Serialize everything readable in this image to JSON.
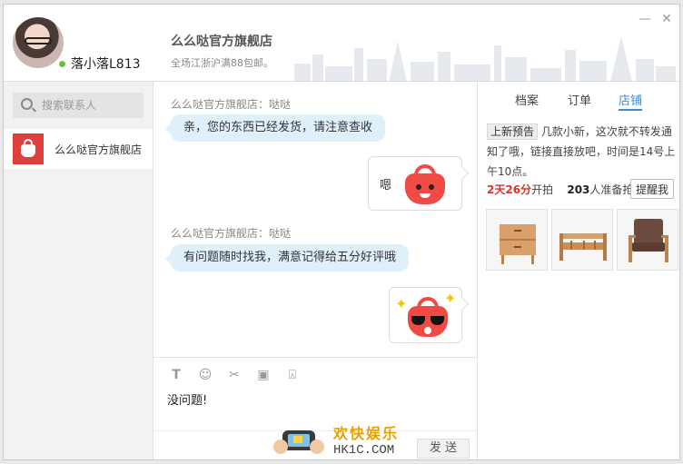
{
  "header": {
    "user_name": "落小落L813",
    "shop_title": "么么哒官方旗舰店",
    "shop_subtitle": "全场江浙沪满88包邮。"
  },
  "window_controls": {
    "minimize": "—",
    "close": "✕"
  },
  "sidebar": {
    "search_placeholder": "搜索联系人",
    "contacts": [
      {
        "name": "么么哒官方旗舰店",
        "icon": "red-bag-logo-icon"
      }
    ]
  },
  "chat": {
    "messages": [
      {
        "sender": "么么哒官方旗舰店：哒哒",
        "text": "亲，您的东西已经发货，请注意查收"
      },
      {
        "mine_text": "嗯",
        "sticker": "red-bag-smile-sticker"
      },
      {
        "sender": "么么哒官方旗舰店：哒哒",
        "text": "有问题随时找我，满意记得给五分好评哦"
      },
      {
        "sticker": "red-bag-sunglasses-sticker",
        "sparkle": "✦"
      }
    ]
  },
  "compose": {
    "tool_icons": [
      "font-icon",
      "emoji-icon",
      "scissors-icon",
      "screen-icon",
      "shake-icon"
    ],
    "draft_text": "没问题!",
    "send_label": "发 送"
  },
  "promo": {
    "brand": "欢快娱乐",
    "domain": "HK1C.COM"
  },
  "right_panel": {
    "tabs": [
      {
        "label": "档案",
        "active": false
      },
      {
        "label": "订单",
        "active": false
      },
      {
        "label": "店铺",
        "active": true
      }
    ],
    "notice_tag": "上新预告",
    "notice_text": "几款小新，这次就不转发通知了哦，链接直接放吧，时间是14号上午10点。",
    "countdown_time": "2天26分",
    "countdown_suffix": "开拍",
    "count_number": "203",
    "count_suffix": "人准备抢",
    "remind_label": "提醒我",
    "products": [
      "nightstand",
      "wooden-bench",
      "armchair"
    ]
  },
  "colors": {
    "accent": "#3c8cd6",
    "brand_red": "#f04a45",
    "bubble": "#dff0fb"
  }
}
